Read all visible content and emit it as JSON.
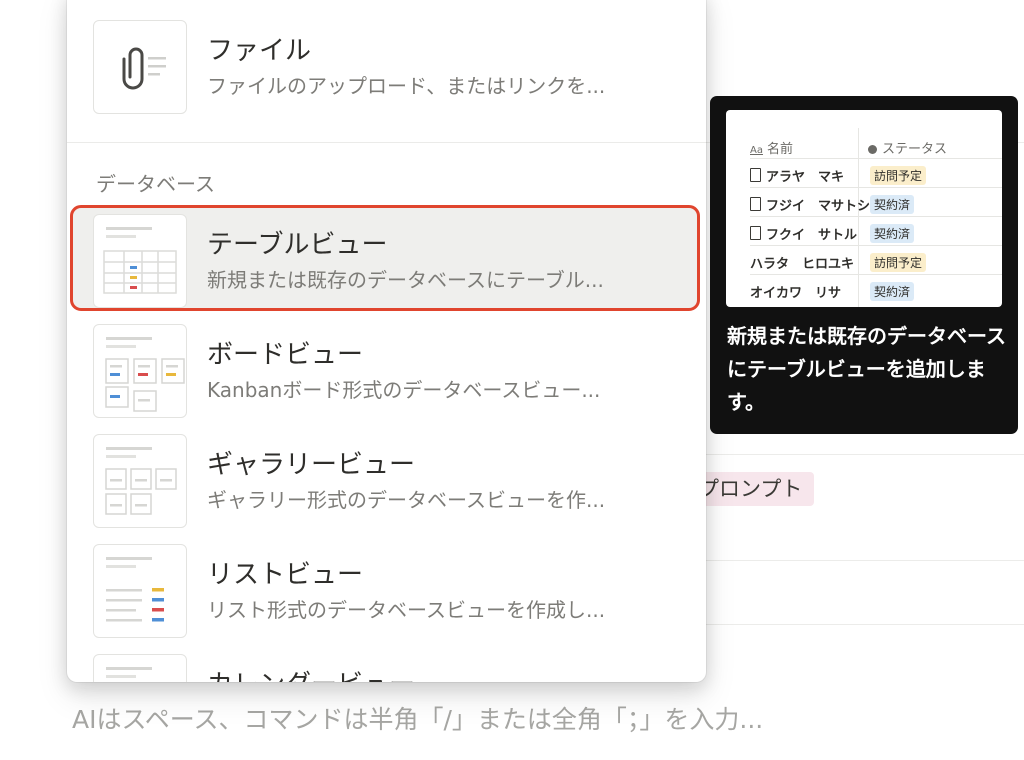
{
  "background": {
    "tag_text": "プロンプト",
    "placeholder": "AIはスペース、コマンドは半角「/」または全角「；」を入力..."
  },
  "menu": {
    "items_top": [
      {
        "title": "ファイル",
        "desc": "ファイルのアップロード、またはリンクを...",
        "icon": "paperclip-icon"
      }
    ],
    "section_label": "データベース",
    "database_items": [
      {
        "title": "テーブルビュー",
        "desc": "新規または既存のデータベースにテーブル...",
        "icon": "table-view-thumbnail",
        "selected": true
      },
      {
        "title": "ボードビュー",
        "desc": "Kanbanボード形式のデータベースビュー...",
        "icon": "board-view-thumbnail"
      },
      {
        "title": "ギャラリービュー",
        "desc": "ギャラリー形式のデータベースビューを作...",
        "icon": "gallery-view-thumbnail"
      },
      {
        "title": "リストビュー",
        "desc": "リスト形式のデータベースビューを作成し...",
        "icon": "list-view-thumbnail"
      },
      {
        "title": "カレンダービュー",
        "desc": "",
        "icon": "calendar-view-thumbnail"
      }
    ]
  },
  "tooltip": {
    "preview": {
      "col_name": "名前",
      "col_status": "ステータス",
      "name_icon_text": "Aa",
      "rows": [
        {
          "name": "アラヤ　マキ",
          "status": "訪問予定"
        },
        {
          "name": "フジイ　マサトシ",
          "status": "契約済"
        },
        {
          "name": "フクイ　サトル",
          "status": "契約済"
        },
        {
          "name": "ハラタ　ヒロユキ",
          "status": "訪問予定"
        },
        {
          "name": "オイカワ　リサ",
          "status": "契約済"
        }
      ]
    },
    "text": "新規または既存のデータベースにテーブルビューを追加します。"
  },
  "colors": {
    "selected_outline": "#e0452e",
    "status_visit": "#fbeecb",
    "status_contract": "#dbeaf7"
  }
}
